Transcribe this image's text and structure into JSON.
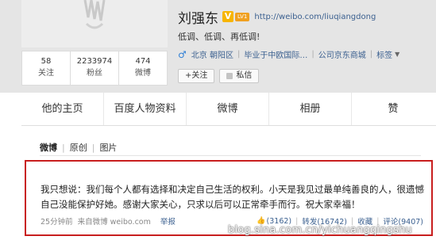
{
  "profile": {
    "name": "刘强东",
    "verified_badge": "V",
    "level_badge": "LV1",
    "url": "http://weibo.com/liuqiangdong",
    "bio": "低调、低调、再低调!",
    "gender_icon": "male-icon",
    "location": "北京 朝阳区",
    "school": "毕业于中欧国际…",
    "company": "公司京东商城",
    "tags_label": "标签",
    "follow_button": "+关注",
    "message_button": "私信"
  },
  "stats": [
    {
      "value": "58",
      "label": "关注"
    },
    {
      "value": "2233974",
      "label": "粉丝"
    },
    {
      "value": "474",
      "label": "微博"
    }
  ],
  "tabs": [
    "他的主页",
    "百度人物资料",
    "微博",
    "相册",
    "赞"
  ],
  "subtabs": [
    "微博",
    "原创",
    "图片"
  ],
  "post": {
    "text": "我只想说：我们每个人都有选择和决定自己生活的权利。小天是我见过最单纯善良的人，很遗憾自己没能保护好她。感谢大家关心，只求以后可以正常牵手而行。祝大家幸福！",
    "time": "25分钟前",
    "source": "来自微博 weibo.com",
    "report": "举报",
    "likes": "(3162)",
    "reposts": "转发(16742)",
    "favorite": "收藏",
    "comments": "评论(9407)"
  },
  "watermark": "blog.sina.com.cn/yichuangqingshu",
  "colors": {
    "highlight_border": "#c81e1e",
    "link": "#3a5f8f",
    "verified": "#f7b500"
  }
}
